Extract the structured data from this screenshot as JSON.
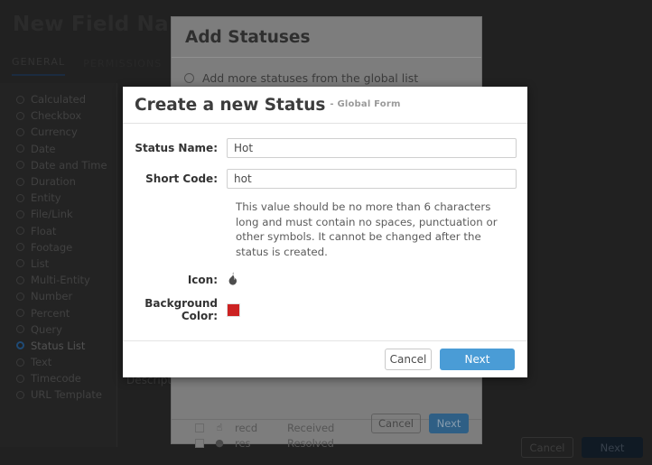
{
  "page": {
    "title": "New Field Name",
    "tabs": [
      {
        "label": "GENERAL",
        "active": true
      },
      {
        "label": "PERMISSIONS",
        "active": false
      }
    ],
    "field_types": [
      {
        "label": "Calculated",
        "selected": false
      },
      {
        "label": "Checkbox",
        "selected": false
      },
      {
        "label": "Currency",
        "selected": false
      },
      {
        "label": "Date",
        "selected": false
      },
      {
        "label": "Date and Time",
        "selected": false
      },
      {
        "label": "Duration",
        "selected": false
      },
      {
        "label": "Entity",
        "selected": false
      },
      {
        "label": "File/Link",
        "selected": false
      },
      {
        "label": "Float",
        "selected": false
      },
      {
        "label": "Footage",
        "selected": false
      },
      {
        "label": "List",
        "selected": false
      },
      {
        "label": "Multi-Entity",
        "selected": false
      },
      {
        "label": "Number",
        "selected": false
      },
      {
        "label": "Percent",
        "selected": false
      },
      {
        "label": "Query",
        "selected": false
      },
      {
        "label": "Status List",
        "selected": true
      },
      {
        "label": "Text",
        "selected": false
      },
      {
        "label": "Timecode",
        "selected": false
      },
      {
        "label": "URL Template",
        "selected": false
      }
    ],
    "description_label": "Description",
    "footer": {
      "cancel_label": "Cancel",
      "next_label": "Next"
    }
  },
  "add_statuses_dialog": {
    "title": "Add Statuses",
    "global_option_label": "Add more statuses from the global list",
    "rows": [
      {
        "icon": "thumbs-up",
        "glyph": "☝",
        "code": "recd",
        "name": "Received"
      },
      {
        "icon": "dot",
        "glyph": "●",
        "code": "res",
        "name": "Resolved"
      }
    ],
    "footer": {
      "cancel_label": "Cancel",
      "next_label": "Next"
    }
  },
  "create_status_modal": {
    "title": "Create a new Status",
    "subtitle": "- Global Form",
    "fields": {
      "status_name": {
        "label": "Status Name:",
        "value": "Hot",
        "placeholder": ""
      },
      "short_code": {
        "label": "Short Code:",
        "value": "hot",
        "placeholder": ""
      },
      "icon": {
        "label": "Icon:",
        "glyph": "▲",
        "icon_name": "flame-icon"
      },
      "background_color": {
        "label": "Background Color:",
        "value": "#cc2222"
      }
    },
    "help_text": "This value should be no more than 6 characters long and must contain no spaces, punctuation or other symbols. It cannot be changed after the status is created.",
    "footer": {
      "cancel_label": "Cancel",
      "next_label": "Next"
    }
  }
}
